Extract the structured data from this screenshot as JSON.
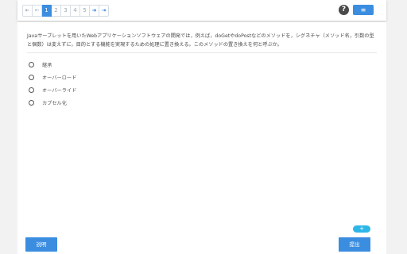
{
  "pager": {
    "first_icon": "first-page-icon",
    "prev_icon": "prev-page-icon",
    "pages": [
      "1",
      "2",
      "3",
      "4",
      "5"
    ],
    "active_page": "1",
    "next_icon": "next-page-icon",
    "last_icon": "last-page-icon",
    "glyphs": {
      "first": "⇤",
      "prev": "←",
      "next": "➜",
      "last": "⇥"
    }
  },
  "header": {
    "help_glyph": "?",
    "menu_glyph": "≡"
  },
  "question": {
    "text": "Javaサーブレットを用いたWebアプリケーションソフトウェアの開発では，例えば，doGetやdoPostなどのメソッドを，シグネチャ（メソッド名，引数の型と個数）は変えずに，目的とする機能を実現するための処理に置き換える。このメソッドの置き換えを何と呼ぶか。"
  },
  "options": [
    {
      "label": "継承"
    },
    {
      "label": "オーバーロード"
    },
    {
      "label": "オーバーライド"
    },
    {
      "label": "カプセル化"
    }
  ],
  "footer": {
    "plus_glyph": "+",
    "explain_label": "説明",
    "submit_label": "提出"
  },
  "colors": {
    "accent": "#3b8de0",
    "plus": "#2fb6e8",
    "background": "#f2f2f2"
  }
}
